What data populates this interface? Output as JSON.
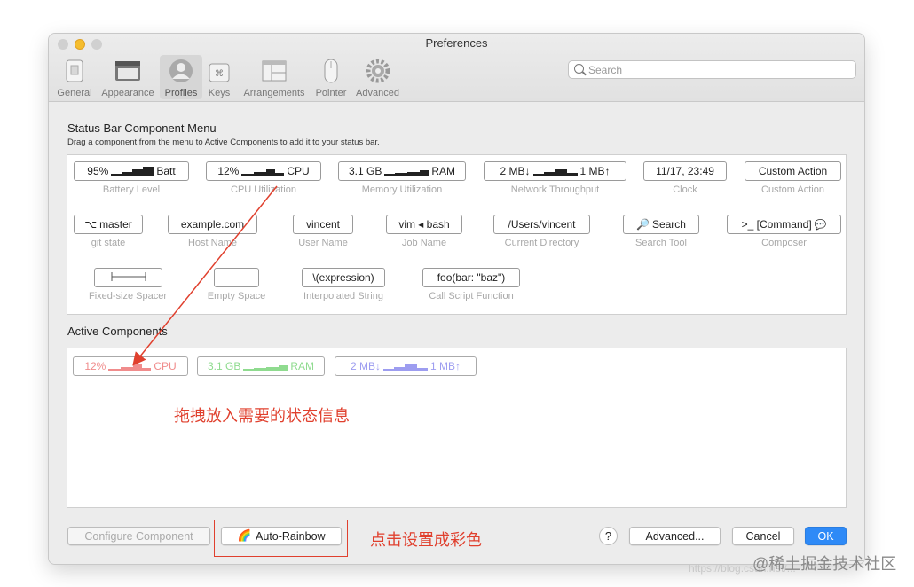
{
  "window": {
    "title": "Preferences"
  },
  "toolbar": {
    "items": [
      {
        "label": "General",
        "icon": "general-icon"
      },
      {
        "label": "Appearance",
        "icon": "appearance-icon"
      },
      {
        "label": "Profiles",
        "icon": "profiles-icon",
        "selected": true
      },
      {
        "label": "Keys",
        "icon": "keys-icon"
      },
      {
        "label": "Arrangements",
        "icon": "arrangements-icon"
      },
      {
        "label": "Pointer",
        "icon": "pointer-icon"
      },
      {
        "label": "Advanced",
        "icon": "gear-icon"
      }
    ]
  },
  "search": {
    "placeholder": "Search"
  },
  "menu": {
    "title": "Status Bar Component Menu",
    "subtitle": "Drag a component from the menu to Active Components to add it to your status bar.",
    "components": [
      {
        "text_left": "95%",
        "text_right": "Batt",
        "caption": "Battery Level"
      },
      {
        "text_left": "12%",
        "text_right": "CPU",
        "caption": "CPU Utilization"
      },
      {
        "text_left": "3.1 GB",
        "text_right": "RAM",
        "caption": "Memory Utilization"
      },
      {
        "text_left": "2 MB↓",
        "text_right": "1 MB↑",
        "caption": "Network Throughput"
      },
      {
        "text": "11/17, 23:49",
        "caption": "Clock"
      },
      {
        "text": "Custom Action",
        "caption": "Custom Action"
      },
      {
        "text": "master",
        "caption": "git state"
      },
      {
        "text": "example.com",
        "caption": "Host Name"
      },
      {
        "text": "vincent",
        "caption": "User Name"
      },
      {
        "text": "vim ◂ bash",
        "caption": "Job Name"
      },
      {
        "text": "/Users/vincent",
        "caption": "Current Directory"
      },
      {
        "text": "Search",
        "caption": "Search Tool"
      },
      {
        "text": ">_ [Command]",
        "caption": "Composer"
      },
      {
        "text": "",
        "caption": "Fixed-size Spacer"
      },
      {
        "text": "",
        "caption": "Empty Space"
      },
      {
        "text": "\\(expression)",
        "caption": "Interpolated String"
      },
      {
        "text": "foo(bar: \"baz\")",
        "caption": "Call Script Function"
      }
    ]
  },
  "active": {
    "title": "Active Components",
    "components": [
      {
        "text_left": "12%",
        "text_right": "CPU",
        "color": "#f08c8c"
      },
      {
        "text_left": "3.1 GB",
        "text_right": "RAM",
        "color": "#8fdb8f"
      },
      {
        "text_left": "2 MB↓",
        "text_right": "1 MB↑",
        "color": "#9d9df0"
      }
    ]
  },
  "annotations": {
    "drag_hint": "拖拽放入需要的状态信息",
    "rainbow_hint": "点击设置成彩色",
    "color": "#e0402e"
  },
  "buttons": {
    "configure": "Configure Component",
    "auto_rainbow": "Auto-Rainbow",
    "help": "?",
    "advanced": "Advanced...",
    "cancel": "Cancel",
    "ok": "OK"
  },
  "watermark": {
    "url": "https://blog.csdn.net/...",
    "site": "@稀土掘金技术社区"
  }
}
